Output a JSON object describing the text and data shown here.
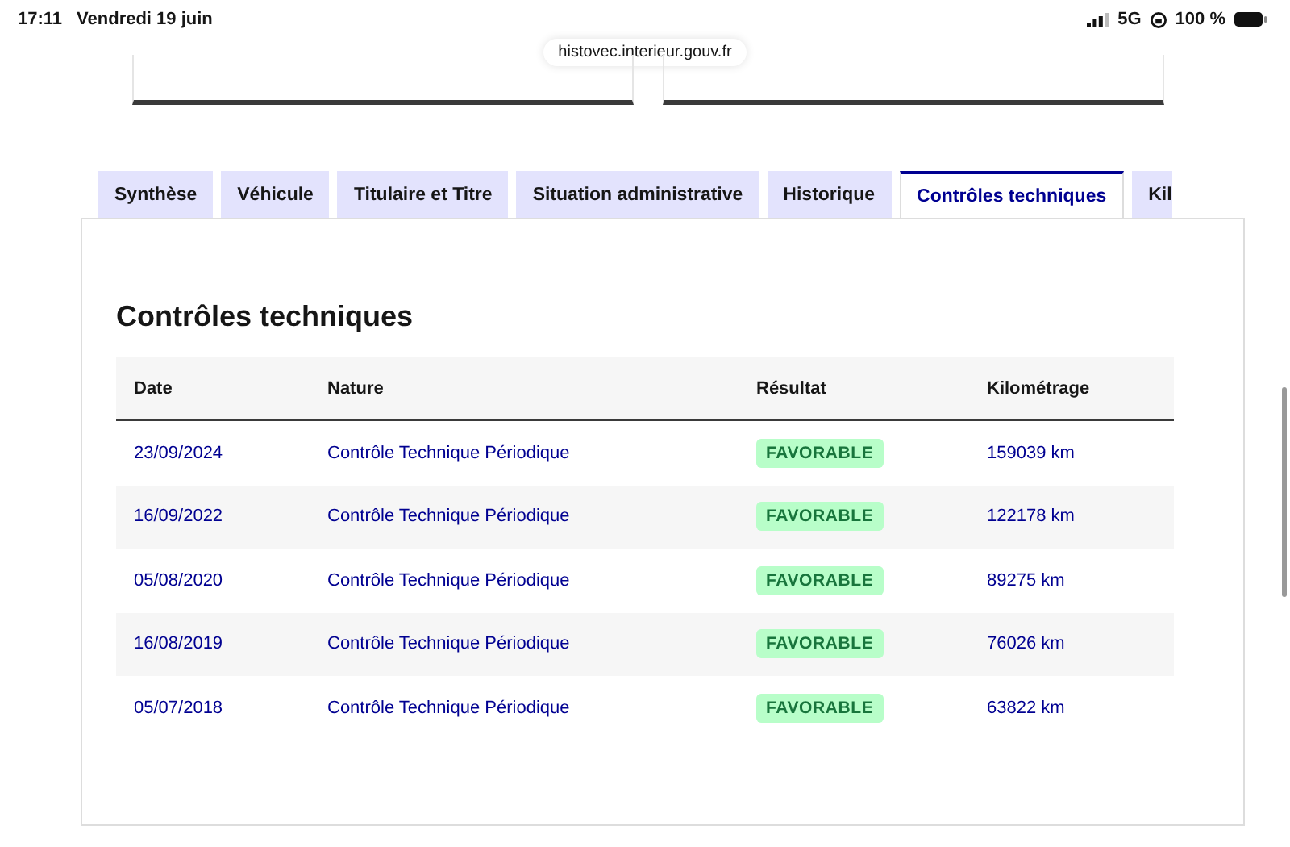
{
  "status_bar": {
    "time": "17:11",
    "date": "Vendredi 19 juin",
    "network": "5G",
    "battery": "100 %"
  },
  "url": "histovec.interieur.gouv.fr",
  "tabs": [
    {
      "label": "Synthèse",
      "selected": false
    },
    {
      "label": "Véhicule",
      "selected": false
    },
    {
      "label": "Titulaire et Titre",
      "selected": false
    },
    {
      "label": "Situation administrative",
      "selected": false
    },
    {
      "label": "Historique",
      "selected": false
    },
    {
      "label": "Contrôles techniques",
      "selected": true
    },
    {
      "label": "Kil",
      "selected": false
    }
  ],
  "section_title": "Contrôles techniques",
  "table": {
    "columns": [
      "Date",
      "Nature",
      "Résultat",
      "Kilométrage"
    ],
    "rows": [
      {
        "date": "23/09/2024",
        "nature": "Contrôle Technique Périodique",
        "result": "FAVORABLE",
        "mileage": "159039 km"
      },
      {
        "date": "16/09/2022",
        "nature": "Contrôle Technique Périodique",
        "result": "FAVORABLE",
        "mileage": "122178 km"
      },
      {
        "date": "05/08/2020",
        "nature": "Contrôle Technique Périodique",
        "result": "FAVORABLE",
        "mileage": "89275 km"
      },
      {
        "date": "16/08/2019",
        "nature": "Contrôle Technique Périodique",
        "result": "FAVORABLE",
        "mileage": "76026 km"
      },
      {
        "date": "05/07/2018",
        "nature": "Contrôle Technique Périodique",
        "result": "FAVORABLE",
        "mileage": "63822 km"
      }
    ]
  }
}
